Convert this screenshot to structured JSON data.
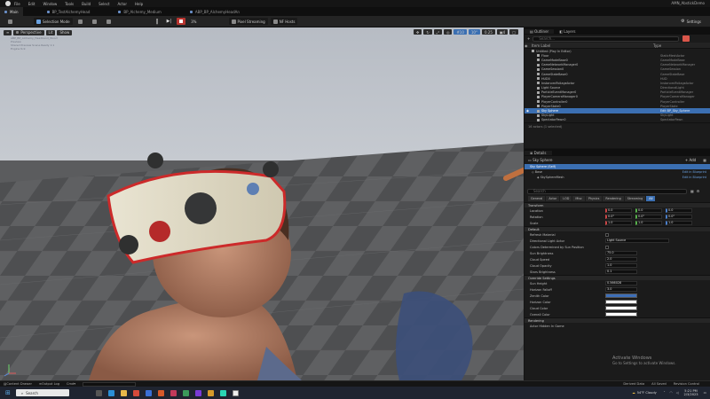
{
  "menubar": {
    "items": [
      "File",
      "Edit",
      "Window",
      "Tools",
      "Build",
      "Select",
      "Actor",
      "Help"
    ],
    "project": "AMN_AbstickDemo"
  },
  "tabs": [
    "Main",
    "BP_TestAlchemyHead",
    "BP_Alchemy_Medium",
    "ABP_BP_AlchemyHeadAn"
  ],
  "toolbar": {
    "selection_mode": "Selection Mode",
    "pixel_streaming": "Pixel Streaming",
    "nf_hosts": "NF Hosts",
    "settings": "Settings",
    "speed": "3%"
  },
  "viewport": {
    "perspective": "Perspective",
    "lit": "Lit",
    "show": "Show",
    "hint_lines": [
      "ABP_BP_Alchemy_Headband_Wood",
      "Preview",
      "Shared Preview Scene Ready 1:1",
      "Engine tick"
    ],
    "camera_speed": "4",
    "fov": "0.25",
    "grid": "10",
    "angle": "10°"
  },
  "outliner": {
    "tabs": [
      "Outliner",
      "Layers"
    ],
    "search_placeholder": "Search...",
    "col_label": "Item Label",
    "col_type": "Type",
    "rows": [
      {
        "name": "Untitled (Play In Editor)",
        "type": ""
      },
      {
        "name": "Floor",
        "type": "StaticMeshActor"
      },
      {
        "name": "GameModeBase0",
        "type": "GameModeBase"
      },
      {
        "name": "GameNetworkManager0",
        "type": "GameNetworkManager"
      },
      {
        "name": "GameSession0",
        "type": "GameSession"
      },
      {
        "name": "GameStateBase0",
        "type": "GameStateBase"
      },
      {
        "name": "HUD0",
        "type": "HUD"
      },
      {
        "name": "InstancedFoliageActor",
        "type": "InstancedFoliageActor"
      },
      {
        "name": "Light Source",
        "type": "DirectionalLight"
      },
      {
        "name": "ParticleEventManager0",
        "type": "ParticleEventManager"
      },
      {
        "name": "PlayerCameraManager0",
        "type": "PlayerCameraManager"
      },
      {
        "name": "PlayerController0",
        "type": "PlayerController"
      },
      {
        "name": "PlayerState0",
        "type": "PlayerState"
      },
      {
        "name": "Sky Sphere",
        "type": "Edit BP_Sky_Sphere"
      },
      {
        "name": "SkyLight",
        "type": "SkyLight"
      },
      {
        "name": "SpectatorPawn0",
        "type": "SpectatorPawn"
      }
    ],
    "selected_index": 13,
    "footer": "16 actors (1 selected)"
  },
  "details": {
    "tab": "Details",
    "actor": "Sky Sphere",
    "add": "+ Add",
    "self_row": "Sky Sphere (Self)",
    "base": "Base",
    "mesh": "SkySphereMesh",
    "edit_bp": "Edit in Blueprint",
    "search_placeholder": "Search",
    "category_tabs": [
      "General",
      "Actor",
      "LOD",
      "Misc",
      "Physics",
      "Rendering",
      "Streaming",
      "All"
    ],
    "transform_header": "Transform",
    "transform": [
      {
        "label": "Location",
        "values": [
          "0.0",
          "0.0",
          "0.0"
        ]
      },
      {
        "label": "Rotation",
        "values": [
          "0.0°",
          "0.0°",
          "0.0°"
        ]
      },
      {
        "label": "Scale",
        "values": [
          "1.0",
          "1.0",
          "1.0"
        ]
      }
    ],
    "default_header": "Default",
    "defaults": [
      {
        "label": "Refresh Material",
        "value": ""
      },
      {
        "label": "Directional Light Actor",
        "value": "Light Source"
      },
      {
        "label": "Colors Determined by Sun Position",
        "value": ""
      },
      {
        "label": "Sun Brightness",
        "value": "75.0"
      },
      {
        "label": "Cloud Speed",
        "value": "2.0"
      },
      {
        "label": "Cloud Opacity",
        "value": "1.0"
      },
      {
        "label": "Stars Brightness",
        "value": "0.1"
      }
    ],
    "override_header": "Override Settings",
    "overrides": [
      {
        "label": "Sun Height",
        "value": "0.566028"
      },
      {
        "label": "Horizon Falloff",
        "value": "3.0"
      },
      {
        "label": "Zenith Color",
        "color": "#3d6fb8"
      },
      {
        "label": "Horizon Color",
        "color": "#ffffff"
      },
      {
        "label": "Cloud Color",
        "color": "#ffffff"
      },
      {
        "label": "Overall Color",
        "color": "#ffffff"
      }
    ],
    "rendering_header": "Rendering",
    "rendering_row": "Actor Hidden In Game"
  },
  "activate": {
    "line1": "Activate Windows",
    "line2": "Go to Settings to activate Windows."
  },
  "statusbar": {
    "items": [
      "Content Drawer",
      "Output Log",
      "Cmd"
    ],
    "right": [
      "Derived Data",
      "All Saved",
      "Revision Control"
    ]
  },
  "taskbar": {
    "search": "Search",
    "weather": "54°F Cloudy",
    "time": "5:21 PM",
    "date": "2/3/2023"
  }
}
